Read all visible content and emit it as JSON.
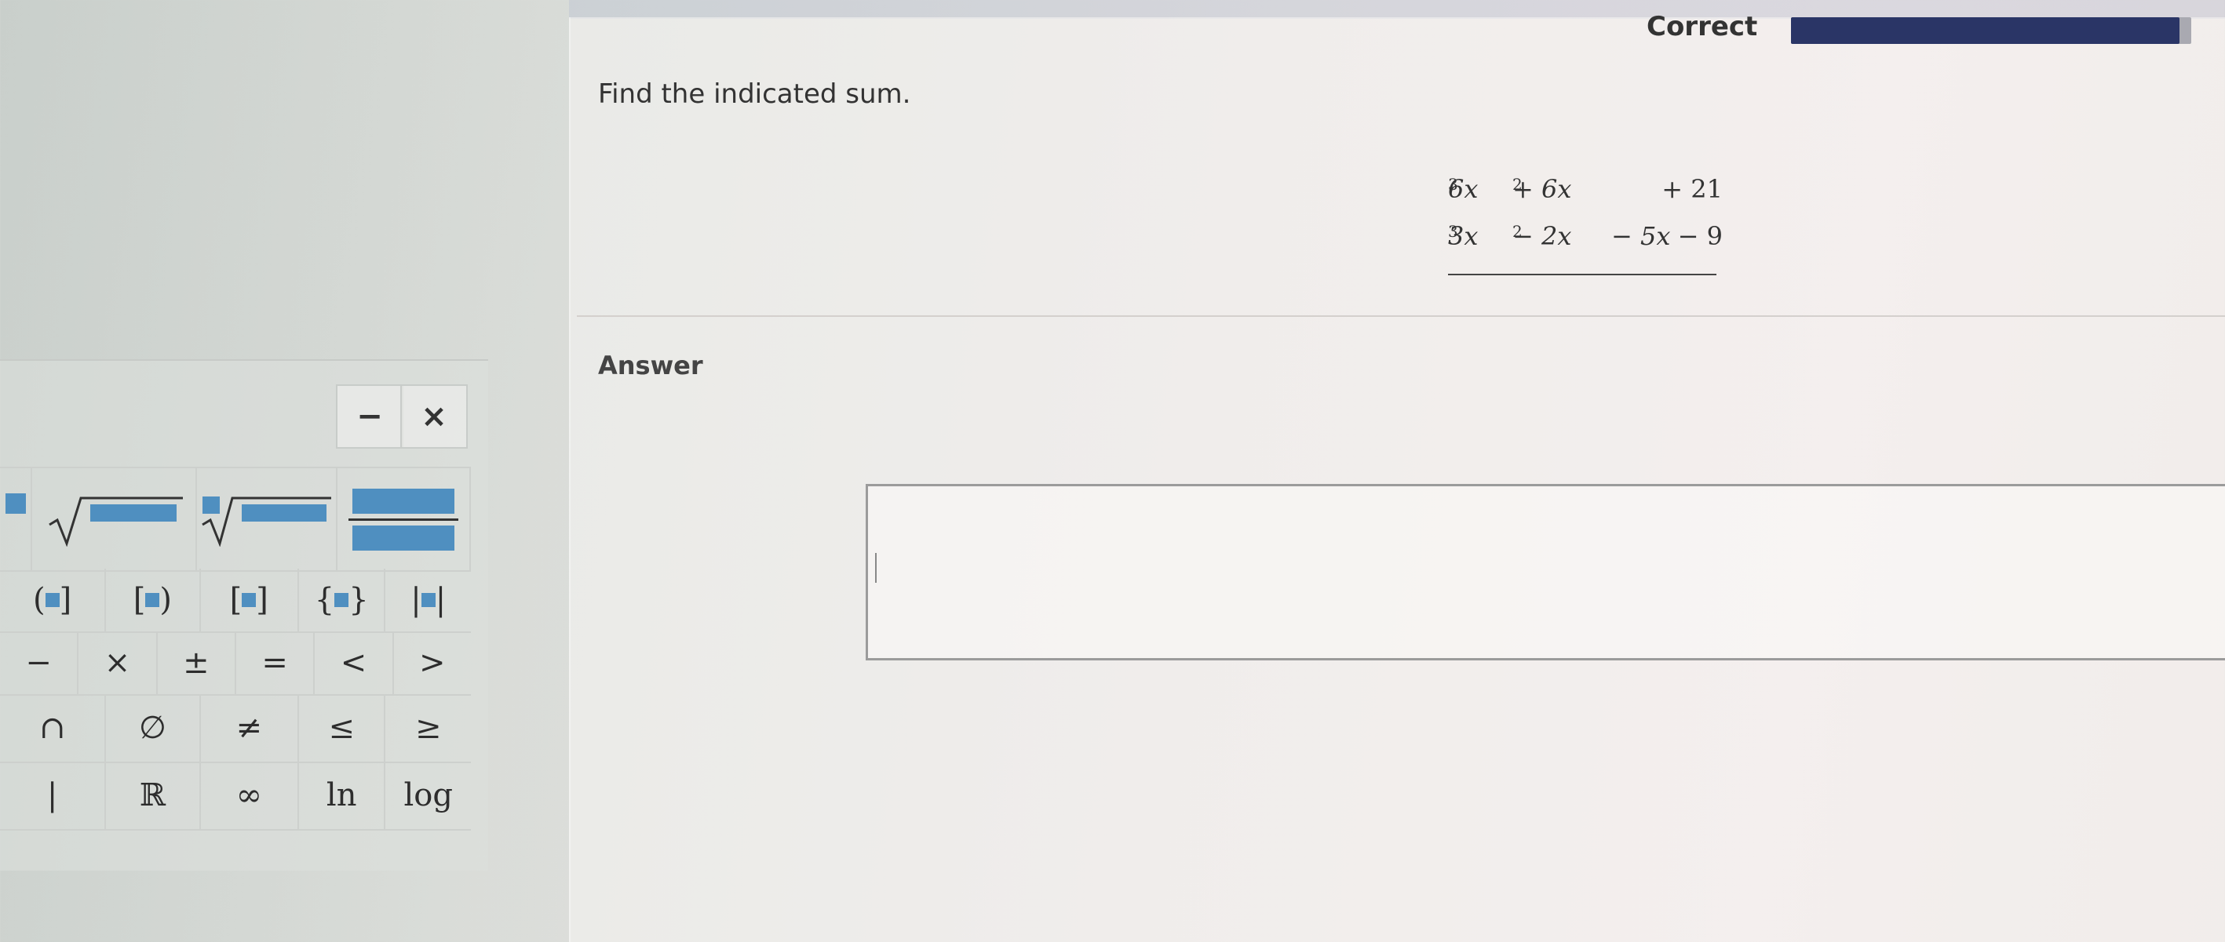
{
  "header": {
    "status": "Correct",
    "progress": 0.97
  },
  "question": {
    "instruction": "Find the indicated sum.",
    "row1": [
      "6x",
      "3",
      "+ 6x",
      "2",
      "+ 21"
    ],
    "row2": [
      "3x",
      "3",
      "− 2x",
      "2",
      "− 5x",
      "− 9"
    ]
  },
  "answer": {
    "label": "Answer",
    "value": ""
  },
  "keypad": {
    "minimize": "−",
    "close": "×",
    "row2": [
      "(",
      ")",
      "[",
      ")",
      "[",
      "]",
      "{",
      "}",
      "|",
      "|"
    ],
    "row3": [
      "−",
      "×",
      "±",
      "=",
      "<",
      ">"
    ],
    "row4": [
      "∩",
      "∅",
      "≠",
      "≤",
      "≥"
    ],
    "row5": [
      "|",
      "ℝ",
      "∞",
      "ln",
      "log"
    ]
  },
  "colors": {
    "accent": "#4f8fc0",
    "progress": "#2a3566"
  }
}
